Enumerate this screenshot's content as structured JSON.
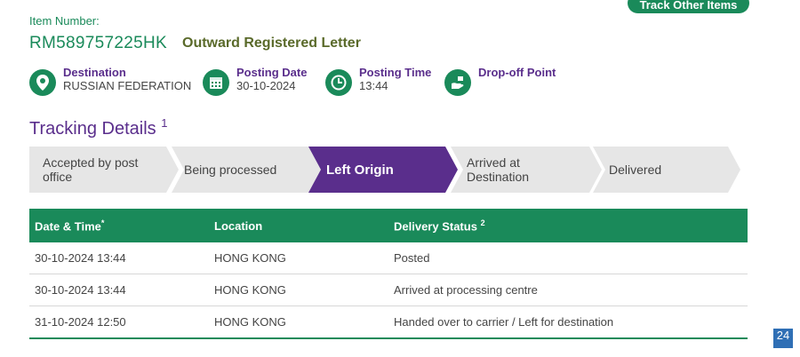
{
  "track_button": "Track Other Items",
  "item": {
    "label": "Item Number:",
    "number": "RM589757225HK",
    "type": "Outward Registered Letter"
  },
  "info": {
    "destination": {
      "title": "Destination",
      "value": "RUSSIAN FEDERATION",
      "icon": "location-pin-icon"
    },
    "posting_date": {
      "title": "Posting Date",
      "value": "30-10-2024",
      "icon": "calendar-icon"
    },
    "posting_time": {
      "title": "Posting Time",
      "value": "13:44",
      "icon": "clock-icon"
    },
    "drop_off": {
      "title": "Drop-off Point",
      "value": "",
      "icon": "hand-drop-icon"
    }
  },
  "tracking": {
    "title": "Tracking Details",
    "title_sup": "1",
    "steps": [
      {
        "label": "Accepted by post office",
        "active": false
      },
      {
        "label": "Being processed",
        "active": false
      },
      {
        "label": "Left Origin",
        "active": true
      },
      {
        "label": "Arrived at Destination",
        "active": false
      },
      {
        "label": "Delivered",
        "active": false
      }
    ]
  },
  "table": {
    "headers": {
      "datetime": "Date & Time",
      "datetime_sup": "*",
      "location": "Location",
      "status": "Delivery Status",
      "status_sup": "2"
    },
    "rows": [
      {
        "datetime": "30-10-2024 13:44",
        "location": "HONG KONG",
        "status": "Posted"
      },
      {
        "datetime": "30-10-2024 13:44",
        "location": "HONG KONG",
        "status": "Arrived at processing centre"
      },
      {
        "datetime": "31-10-2024 12:50",
        "location": "HONG KONG",
        "status": "Handed over to carrier / Left for destination"
      }
    ]
  },
  "page_badge": "24",
  "colors": {
    "green": "#1a8a5a",
    "purple": "#5a2e8c",
    "step_grey": "#e6e6e6",
    "badge_blue": "#2f6fb5"
  }
}
